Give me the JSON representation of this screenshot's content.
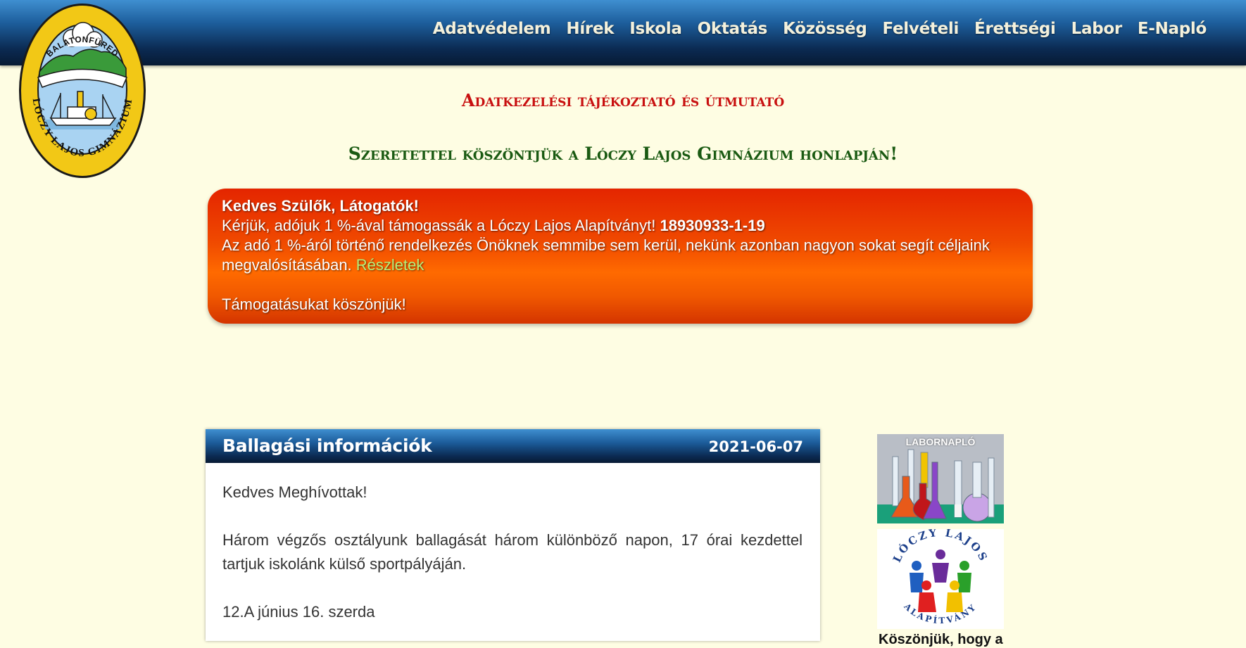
{
  "nav": {
    "items": [
      {
        "label": "Adatvédelem"
      },
      {
        "label": "Hírek"
      },
      {
        "label": "Iskola"
      },
      {
        "label": "Oktatás"
      },
      {
        "label": "Közösség"
      },
      {
        "label": "Felvételi"
      },
      {
        "label": "Érettségi"
      },
      {
        "label": "Labor"
      },
      {
        "label": "E-Napló"
      }
    ]
  },
  "logo": {
    "top_text": "BALATONFÜRED",
    "ring_text": "LÓCZY LAJOS GIMNÁZIUM"
  },
  "titles": {
    "privacy": "Adatkezelési tájékoztató és útmutató",
    "welcome": "Szeretettel köszöntjük a Lóczy Lajos Gimnázium honlapján!"
  },
  "banner": {
    "greeting": "Kedves Szülők, Látogatók!",
    "line1": "Kérjük, adójuk 1 %-ával támogassák a Lóczy Lajos Alapítványt!",
    "tax_number": "18930933-1-19",
    "line2": "Az adó 1 %-áról történő rendelkezés Önöknek semmibe sem kerül, nekünk azonban nagyon sokat segít céljaink megvalósításában.",
    "details_link": "Részletek",
    "thanks": "Támogatásukat köszönjük!"
  },
  "article": {
    "title": "Ballagási információk",
    "date": "2021-06-07",
    "p1": "Kedves Meghívottak!",
    "p2": "Három végzős osztályunk ballagását három különböző napon, 17 órai kezdettel tartjuk iskolánk külső sportpályáján.",
    "p3": "12.A június 16. szerda"
  },
  "sidebar": {
    "labor_label": "LABORNAPLÓ",
    "alap_top": "LÓCZY LAJOS",
    "alap_bottom": "ALAPÍTVÁNY",
    "caption": "Köszönjük, hogy a"
  },
  "colors": {
    "background": "#fefde3",
    "nav_dark": "#0b2a52",
    "title_red": "#c81010",
    "title_green": "#1a5a12",
    "banner_orange": "#ff6a00",
    "link_green": "#b6f07a"
  }
}
